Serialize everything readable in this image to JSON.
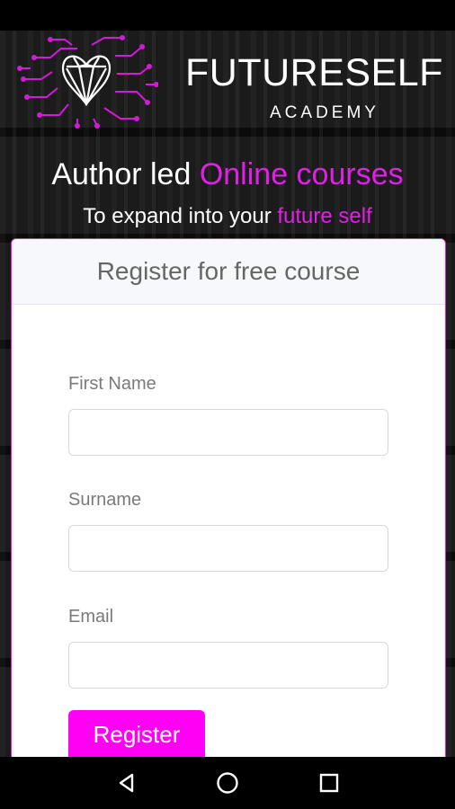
{
  "brand": {
    "title": "FUTURESELF",
    "subtitle": "ACADEMY",
    "logo_icon": "circuit-heart-icon",
    "accent_color": "#e020e6"
  },
  "hero": {
    "headline_plain": "Author led ",
    "headline_accent": "Online courses",
    "subheadline_plain": "To expand into your ",
    "subheadline_accent": "future self"
  },
  "form": {
    "header": "Register for free course",
    "fields": [
      {
        "label": "First Name",
        "value": "",
        "placeholder": ""
      },
      {
        "label": "Surname",
        "value": "",
        "placeholder": ""
      },
      {
        "label": "Email",
        "value": "",
        "placeholder": ""
      }
    ],
    "submit_label": "Register",
    "submit_color": "#ff00f5"
  },
  "navigation": {
    "buttons": [
      {
        "icon": "back-triangle-icon"
      },
      {
        "icon": "home-circle-icon"
      },
      {
        "icon": "recents-square-icon"
      }
    ]
  }
}
